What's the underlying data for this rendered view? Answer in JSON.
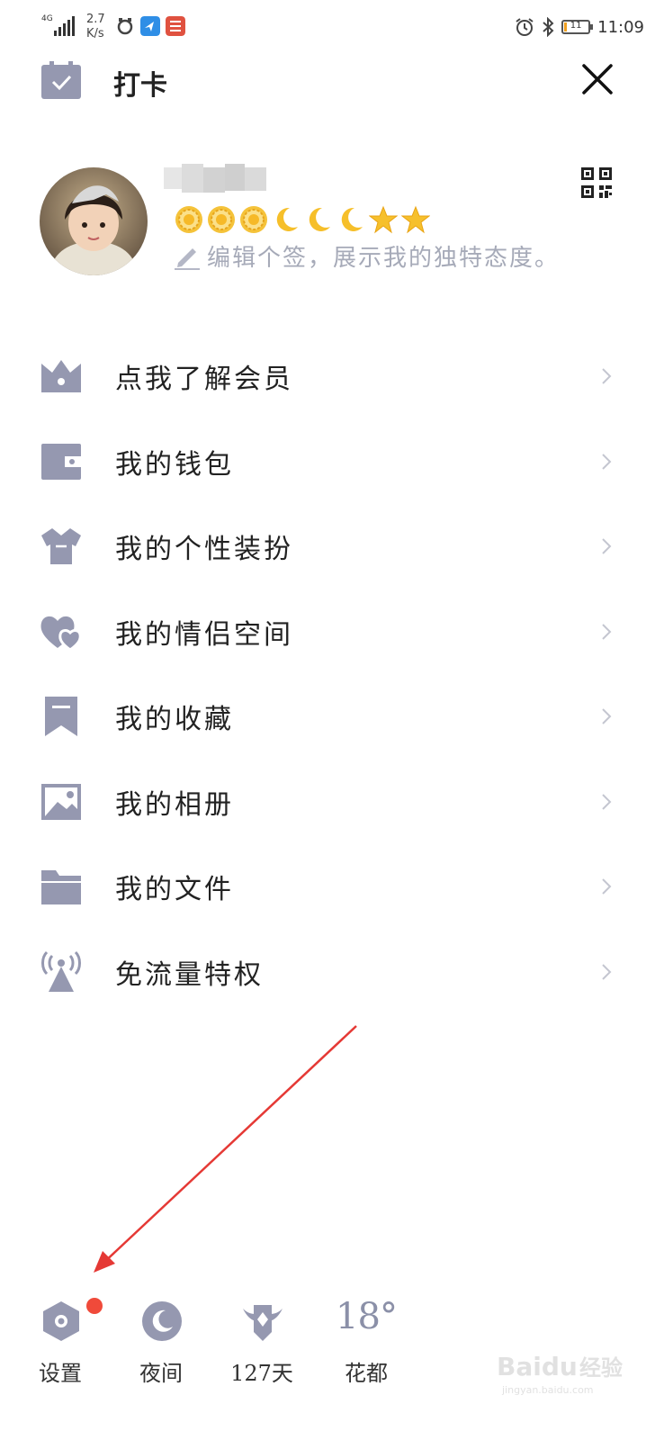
{
  "status_bar": {
    "network": "4G",
    "speed_value": "2.7",
    "speed_unit": "K/s",
    "battery": "11",
    "battery_level_fraction": 0.11,
    "time": "11:09"
  },
  "header": {
    "title": "打卡"
  },
  "profile": {
    "signature_placeholder": "编辑个签，展示我的独特态度。",
    "level_badges": [
      "sun",
      "sun",
      "sun",
      "moon",
      "moon",
      "moon",
      "star",
      "star"
    ]
  },
  "menu": {
    "items": [
      {
        "label": "点我了解会员",
        "icon": "vip-crown-icon"
      },
      {
        "label": "我的钱包",
        "icon": "wallet-icon"
      },
      {
        "label": "我的个性装扮",
        "icon": "tshirt-icon"
      },
      {
        "label": "我的情侣空间",
        "icon": "couple-hearts-icon"
      },
      {
        "label": "我的收藏",
        "icon": "bookmark-icon"
      },
      {
        "label": "我的相册",
        "icon": "photo-album-icon"
      },
      {
        "label": "我的文件",
        "icon": "folder-icon"
      },
      {
        "label": "免流量特权",
        "icon": "signal-tower-icon"
      }
    ]
  },
  "bottom_bar": {
    "settings_label": "设置",
    "night_label": "夜间",
    "days_label": "127天",
    "temperature": "18°",
    "city_label": "花都"
  },
  "colors": {
    "icon": "#9598b0",
    "icon_dark": "#8a8ea6",
    "chevron": "#c4c6d0",
    "notification_dot": "#f04a3a",
    "annotation": "#e53935"
  }
}
